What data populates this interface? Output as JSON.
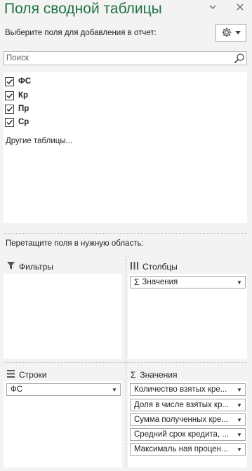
{
  "header": {
    "title": "Поля сводной таблицы",
    "hint": "Выберите поля для добавления в отчет:"
  },
  "search": {
    "placeholder": "Поиск"
  },
  "fields": [
    {
      "label": "ФС",
      "checked": true
    },
    {
      "label": "Кр",
      "checked": true
    },
    {
      "label": "Пр",
      "checked": true
    },
    {
      "label": "Ср",
      "checked": true
    }
  ],
  "other_tables": "Другие таблицы...",
  "drag_hint": "Перетащите поля в нужную область:",
  "areas": {
    "filters": {
      "label": "Фильтры"
    },
    "columns": {
      "label": "Столбцы",
      "items": [
        "Значения"
      ]
    },
    "rows": {
      "label": "Строки",
      "items": [
        "ФС"
      ]
    },
    "values": {
      "label": "Значения",
      "items": [
        "Количество взятых кре...",
        "Доля в числе взятых кр...",
        "Сумма полученных кре...",
        "Средний срок кредита, ...",
        "Максималь ная процен..."
      ]
    }
  },
  "colors": {
    "title": "#217346",
    "panel_bg": "#f3f3f3"
  }
}
